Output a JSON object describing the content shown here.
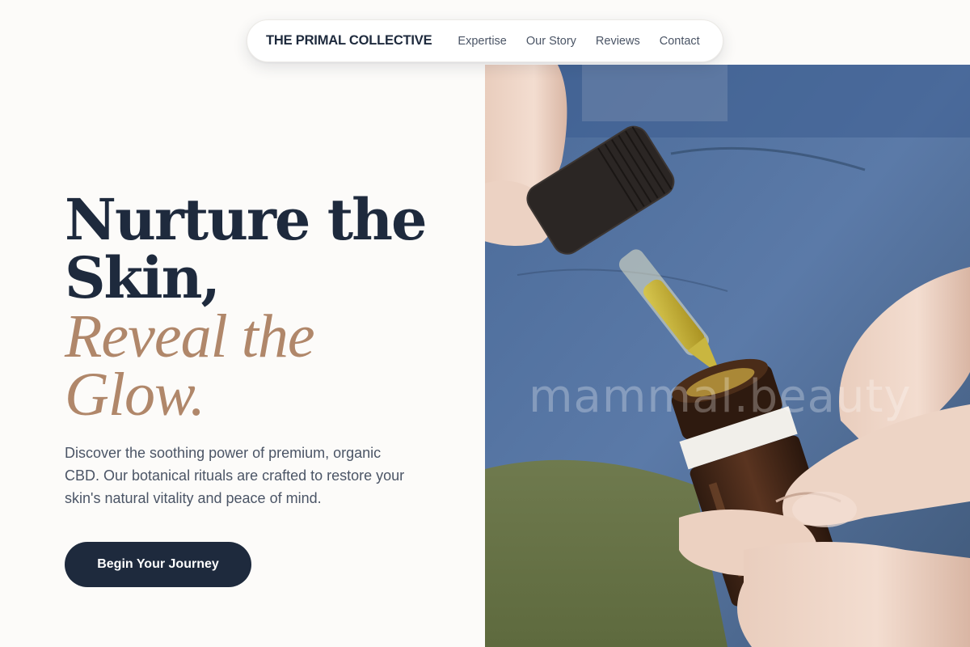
{
  "nav": {
    "brand": "THE PRIMAL COLLECTIVE",
    "links": [
      "Expertise",
      "Our Story",
      "Reviews",
      "Contact"
    ]
  },
  "hero": {
    "headline_line1": "Nurture the",
    "headline_line2": "Skin,",
    "headline_accent_line1": "Reveal the",
    "headline_accent_line2": "Glow.",
    "lede": "Discover the soothing power of premium, organic CBD. Our botanical rituals are crafted to restore your skin's natural vitality and peace of mind.",
    "cta_label": "Begin Your Journey"
  },
  "image": {
    "watermark": "mammal.beauty"
  },
  "colors": {
    "background": "#fcfbf9",
    "navy": "#1e2a3d",
    "accent": "#b0876a",
    "body_text": "#4b5566"
  }
}
